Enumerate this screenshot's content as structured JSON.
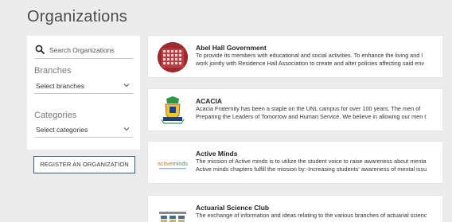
{
  "page": {
    "title": "Organizations"
  },
  "sidebar": {
    "search": {
      "placeholder": "Search Organizations"
    },
    "branches": {
      "label": "Branches",
      "selected": "Select branches"
    },
    "categories": {
      "label": "Categories",
      "selected": "Select categories"
    },
    "register_label": "REGISTER AN ORGANIZATION"
  },
  "organizations": [
    {
      "name": "Abel Hall Government",
      "desc_line1": "To provide its members with educational and social activities. To enhance the living and l",
      "desc_line2": "work jointly with Residence Hall Association to create and alter policies affecting said env",
      "logo": "abel-hall-logo"
    },
    {
      "name": "ACACIA",
      "desc_line1": "Acacia Fraternity has been a staple on the UNL campus for over 100 years. The men of",
      "desc_line2": "Preparing the Leaders of Tomorrow and Human Service. We believe in allowing our men t",
      "logo": "acacia-crest-logo"
    },
    {
      "name": "Active Minds",
      "desc_line1": "The mission of Active minds is to utilize the student voice to raise awareness about menta",
      "desc_line2": "Active minds chapters fulfill the mission by:-Increasing students' awareness of mental issu",
      "logo": "active-minds-logo",
      "logo_text": "activeminds"
    },
    {
      "name": "Actuarial Science Club",
      "desc_line1": "The exchange of information and ideas relating to the various branches of actuarial scienc",
      "desc_line2": "",
      "logo": "actuarial-club-logo"
    }
  ]
}
